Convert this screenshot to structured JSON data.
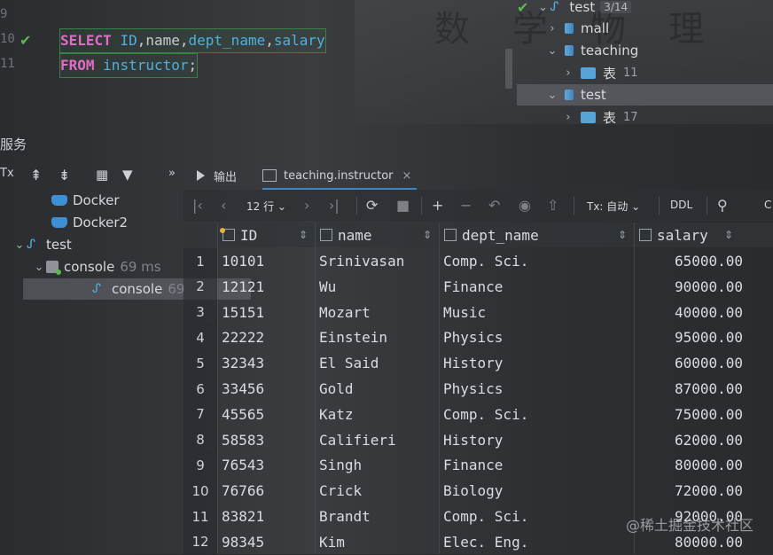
{
  "editor": {
    "line_numbers": [
      "9",
      "10",
      "11"
    ],
    "line10": {
      "kw": "SELECT",
      "cols": [
        {
          "t": "ID",
          "c": "fld"
        },
        {
          "t": ",",
          "c": "id"
        },
        {
          "t": "name",
          "c": "id"
        },
        {
          "t": ",",
          "c": "id"
        },
        {
          "t": "dept_name",
          "c": "fld"
        },
        {
          "t": ",",
          "c": "id"
        },
        {
          "t": "salary",
          "c": "fld"
        }
      ]
    },
    "line11": {
      "kw": "FROM",
      "table": "instructor",
      "end": ";"
    },
    "check_glyph": "✔"
  },
  "db_tree": {
    "root_label": "test",
    "root_badge": "3/14",
    "items": [
      {
        "label": "mall",
        "level": 1,
        "chev": "›",
        "kind": "db"
      },
      {
        "label": "teaching",
        "level": 1,
        "chev": "⌄",
        "kind": "db"
      },
      {
        "label": "表",
        "count": "11",
        "level": 2,
        "chev": "›",
        "kind": "folder"
      },
      {
        "label": "test",
        "level": 1,
        "chev": "⌄",
        "kind": "db",
        "selected": true
      },
      {
        "label": "表",
        "count": "17",
        "level": 2,
        "chev": "›",
        "kind": "folder"
      }
    ]
  },
  "services": {
    "title": "服务",
    "toolbar_tx": "Tx",
    "items": [
      {
        "label": "Docker",
        "icon": "docker-icon",
        "indent": 58
      },
      {
        "label": "Docker2",
        "icon": "docker-icon",
        "indent": 58
      },
      {
        "label": "test",
        "icon": "datasource-icon",
        "indent": 36,
        "chev": "⌄"
      },
      {
        "label": "console",
        "suffix": "69 ms",
        "icon": "console-icon",
        "indent": 58,
        "chev": "⌄"
      },
      {
        "label": "console",
        "suffix": "69",
        "icon": "datasource-icon",
        "indent": 104,
        "selected": true
      }
    ]
  },
  "result": {
    "tabs": [
      {
        "label": "输出",
        "icon": "output-icon"
      },
      {
        "label": "teaching.instructor",
        "icon": "table-icon",
        "active": true,
        "close": "×"
      }
    ],
    "toolbar": {
      "rows_label": "12 行",
      "tx_label": "Tx: 自动",
      "ddl_label": "DDL",
      "extra": "C"
    },
    "columns": [
      {
        "name": "ID",
        "key": true
      },
      {
        "name": "name"
      },
      {
        "name": "dept_name"
      },
      {
        "name": "salary"
      }
    ],
    "rows": [
      [
        "1",
        "10101",
        "Srinivasan",
        "Comp. Sci.",
        "65000.00"
      ],
      [
        "2",
        "12121",
        "Wu",
        "Finance",
        "90000.00"
      ],
      [
        "3",
        "15151",
        "Mozart",
        "Music",
        "40000.00"
      ],
      [
        "4",
        "22222",
        "Einstein",
        "Physics",
        "95000.00"
      ],
      [
        "5",
        "32343",
        "El Said",
        "History",
        "60000.00"
      ],
      [
        "6",
        "33456",
        "Gold",
        "Physics",
        "87000.00"
      ],
      [
        "7",
        "45565",
        "Katz",
        "Comp. Sci.",
        "75000.00"
      ],
      [
        "8",
        "58583",
        "Califieri",
        "History",
        "62000.00"
      ],
      [
        "9",
        "76543",
        "Singh",
        "Finance",
        "80000.00"
      ],
      [
        "10",
        "76766",
        "Crick",
        "Biology",
        "72000.00"
      ],
      [
        "11",
        "83821",
        "Brandt",
        "Comp. Sci.",
        "92000.00"
      ],
      [
        "12",
        "98345",
        "Kim",
        "Elec. Eng.",
        "80000.00"
      ]
    ]
  },
  "watermark": "@稀土掘金技术社区",
  "background_chars": "数学物理"
}
